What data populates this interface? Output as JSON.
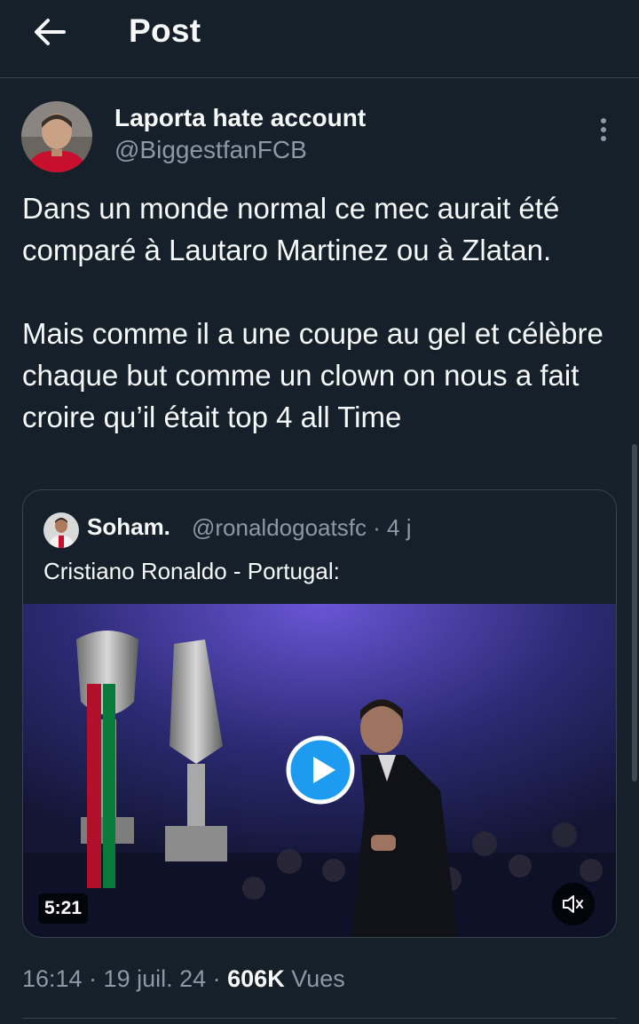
{
  "header": {
    "back_icon": "arrow-left-icon",
    "title": "Post"
  },
  "author": {
    "display_name": "Laporta hate account",
    "handle": "@BiggestfanFCB"
  },
  "tweet": {
    "text": "Dans un monde normal ce mec aurait été comparé à Lautaro Martinez ou à Zlatan.\n\nMais comme il a une coupe au gel et célèbre chaque but comme un clown on nous a fait croire qu’il était top 4 all Time"
  },
  "quote": {
    "display_name": "Soham.",
    "handle_time": "@ronaldogoatsfc · 4 j",
    "text": "Cristiano Ronaldo - Portugal:",
    "video": {
      "duration": "5:21",
      "play_icon": "play-icon",
      "mute_icon": "volume-muted-icon"
    }
  },
  "meta": {
    "time_date": "16:14 · 19 juil. 24 · ",
    "views_count": "606K",
    "views_label": " Vues"
  },
  "colors": {
    "background": "#15202b",
    "text_primary": "#f7f9f9",
    "text_secondary": "#8b98a5",
    "border": "#38444d",
    "accent": "#1d9bf0"
  }
}
